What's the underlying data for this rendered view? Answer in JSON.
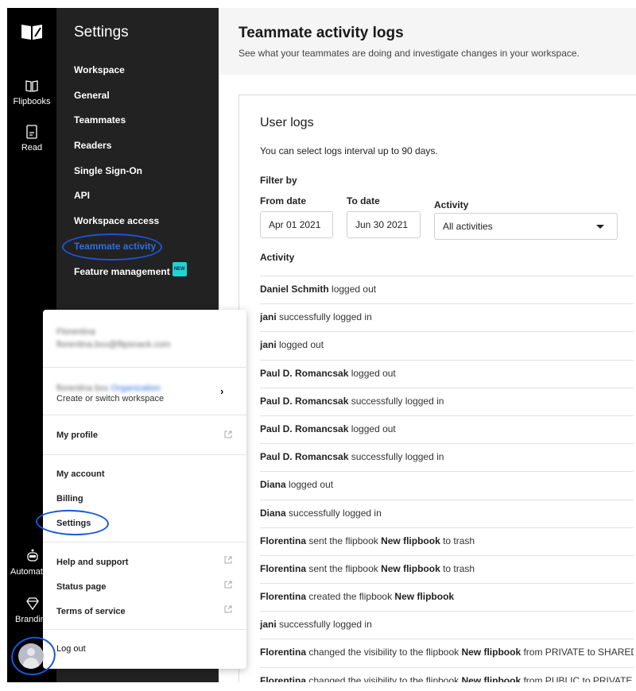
{
  "rail": {
    "items": [
      {
        "label": "Flipbooks",
        "icon": "book-open-icon"
      },
      {
        "label": "Read",
        "icon": "document-icon"
      },
      {
        "label": "Automati",
        "icon": "robot-icon"
      },
      {
        "label": "Brandin",
        "icon": "diamond-icon"
      }
    ]
  },
  "settings": {
    "title": "Settings",
    "items": [
      {
        "label": "Workspace"
      },
      {
        "label": "General"
      },
      {
        "label": "Teammates"
      },
      {
        "label": "Readers"
      },
      {
        "label": "Single Sign-On"
      },
      {
        "label": "API"
      },
      {
        "label": "Workspace access"
      },
      {
        "label": "Teammate activity",
        "active": true
      },
      {
        "label": "Feature management",
        "badge": "NEW"
      }
    ]
  },
  "main": {
    "title": "Teammate activity logs",
    "subtitle": "See what your teammates are doing and investigate changes in your workspace.",
    "card": {
      "title": "User logs",
      "hint": "You can select logs interval up to 90 days.",
      "filter_label": "Filter by",
      "from_label": "From date",
      "from_value": "Apr 01 2021",
      "to_label": "To date",
      "to_value": "Jun 30 2021",
      "activity_label": "Activity",
      "activity_value": "All activities",
      "list_label": "Activity"
    },
    "logs": [
      {
        "user": "Daniel Schmith",
        "text": " logged out"
      },
      {
        "user": "jani",
        "text": " successfully logged in"
      },
      {
        "user": "jani",
        "text": " logged out"
      },
      {
        "user": "Paul D. Romancsak",
        "text": " logged out"
      },
      {
        "user": "Paul D. Romancsak",
        "text": " successfully logged in"
      },
      {
        "user": "Paul D. Romancsak",
        "text": " logged out"
      },
      {
        "user": "Paul D. Romancsak",
        "text": " successfully logged in"
      },
      {
        "user": "Diana",
        "text": " logged out"
      },
      {
        "user": "Diana",
        "text": " successfully logged in"
      },
      {
        "user": "Florentina",
        "text": " sent the flipbook ",
        "object": "New flipbook",
        "tail": " to trash"
      },
      {
        "user": "Florentina",
        "text": " sent the flipbook ",
        "object": "New flipbook",
        "tail": " to trash"
      },
      {
        "user": "Florentina",
        "text": " created the flipbook ",
        "object": "New flipbook",
        "tail": ""
      },
      {
        "user": "jani",
        "text": " successfully logged in"
      },
      {
        "user": "Florentina",
        "text": " changed the visibility to the flipbook ",
        "object": "New flipbook",
        "tail": " from PRIVATE to SHARED_"
      },
      {
        "user": "Florentina",
        "text": " changed the visibility to the flipbook ",
        "object": "New flipbook",
        "tail": " from PUBLIC to PRIVATE"
      }
    ]
  },
  "popup": {
    "user_name": "Florentina",
    "user_email": "florentina.bxx@flipsnack.com",
    "workspace_name": "florentina bxx",
    "workspace_type": "Organization",
    "workspace_action": "Create or switch workspace",
    "items": {
      "my_profile": "My profile",
      "my_account": "My account",
      "billing": "Billing",
      "settings": "Settings",
      "help": "Help and support",
      "status": "Status page",
      "terms": "Terms of service",
      "logout": "Log out"
    }
  },
  "colors": {
    "accent": "#2f6fe0",
    "annotation": "#1a56db",
    "new_badge": "#21d4d4",
    "sidebar_bg": "#222222",
    "rail_bg": "#000000"
  }
}
